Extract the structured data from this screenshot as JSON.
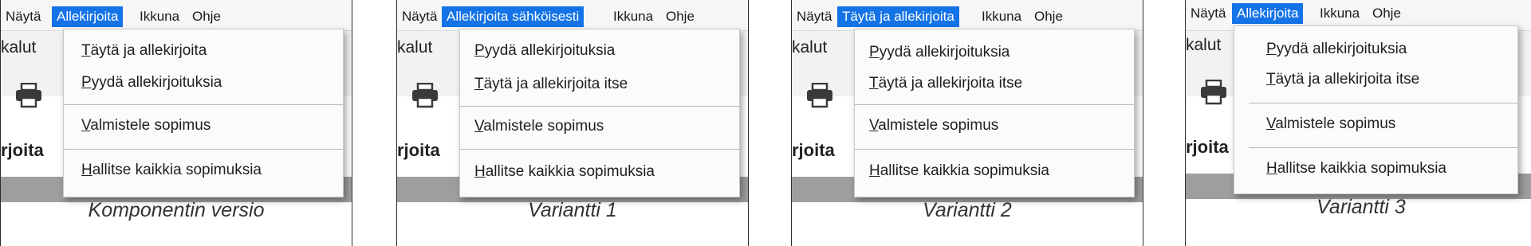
{
  "colors": {
    "menu_highlight": "#1473e6",
    "band_gray": "#9e9e9e"
  },
  "panels": [
    {
      "menubar": [
        "Näytä",
        "Allekirjoita",
        "Ikkuna",
        "Ohje"
      ],
      "active_menu": "Allekirjoita",
      "items": [
        "Täytä ja allekirjoita",
        "Pyydä allekirjoituksia",
        "Valmistele sopimus",
        "Hallitse kaikkia sopimuksia"
      ],
      "caption": "Komponentin versio"
    },
    {
      "menubar": [
        "Näytä",
        "Allekirjoita sähköisesti",
        "Ikkuna",
        "Ohje"
      ],
      "active_menu": "Allekirjoita sähköisesti",
      "items": [
        "Pyydä allekirjoituksia",
        "Täytä ja allekirjoita itse",
        "Valmistele sopimus",
        "Hallitse kaikkia sopimuksia"
      ],
      "caption": "Variantti 1"
    },
    {
      "menubar": [
        "Näytä",
        "Täytä ja allekirjoita",
        "Ikkuna",
        "Ohje"
      ],
      "active_menu": "Täytä ja allekirjoita",
      "items": [
        "Pyydä allekirjoituksia",
        "Täytä ja allekirjoita itse",
        "Valmistele sopimus",
        "Hallitse kaikkia sopimuksia"
      ],
      "caption": "Variantti 2"
    },
    {
      "menubar": [
        "Näytä",
        "Allekirjoita",
        "Ikkuna",
        "Ohje"
      ],
      "active_menu": "Allekirjoita",
      "items": [
        "Pyydä allekirjoituksia",
        "Täytä ja allekirjoita itse",
        "Valmistele sopimus",
        "Hallitse kaikkia sopimuksia"
      ],
      "caption": "Variantti 3"
    }
  ],
  "background_labels": {
    "tools_fragment": "kalut",
    "sign_fragment": "rjoita"
  },
  "icons": {
    "printer": "printer-icon"
  }
}
